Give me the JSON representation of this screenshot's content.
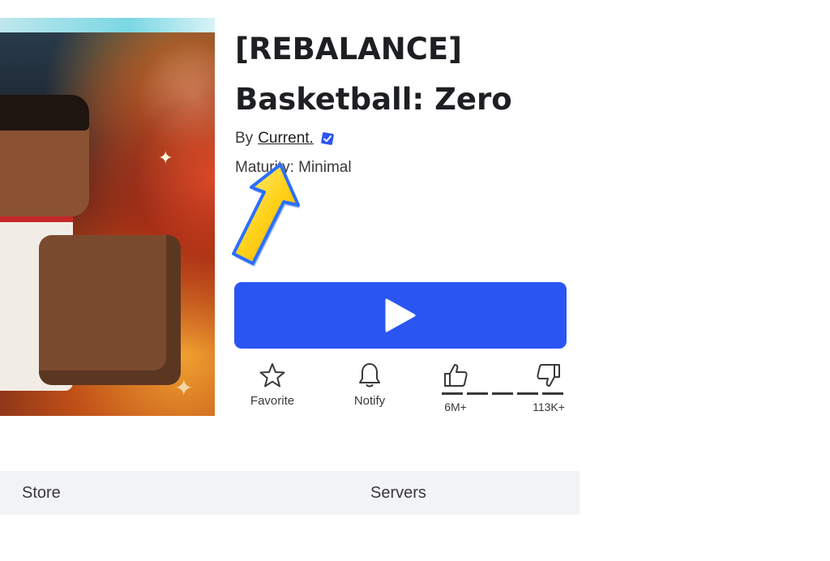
{
  "game": {
    "title_line1": "[REBALANCE]",
    "title_line2": "Basketball: Zero",
    "by_prefix": "By",
    "creator": "Current.",
    "maturity": "Maturity: Minimal"
  },
  "actions": {
    "favorite": "Favorite",
    "notify": "Notify"
  },
  "votes": {
    "likes": "6M+",
    "dislikes": "113K+"
  },
  "tabs": [
    "Store",
    "Servers"
  ],
  "colors": {
    "play_button": "#2b55f2",
    "verified_badge": "#2b55f2",
    "tab_bar": "#f2f3f5"
  }
}
